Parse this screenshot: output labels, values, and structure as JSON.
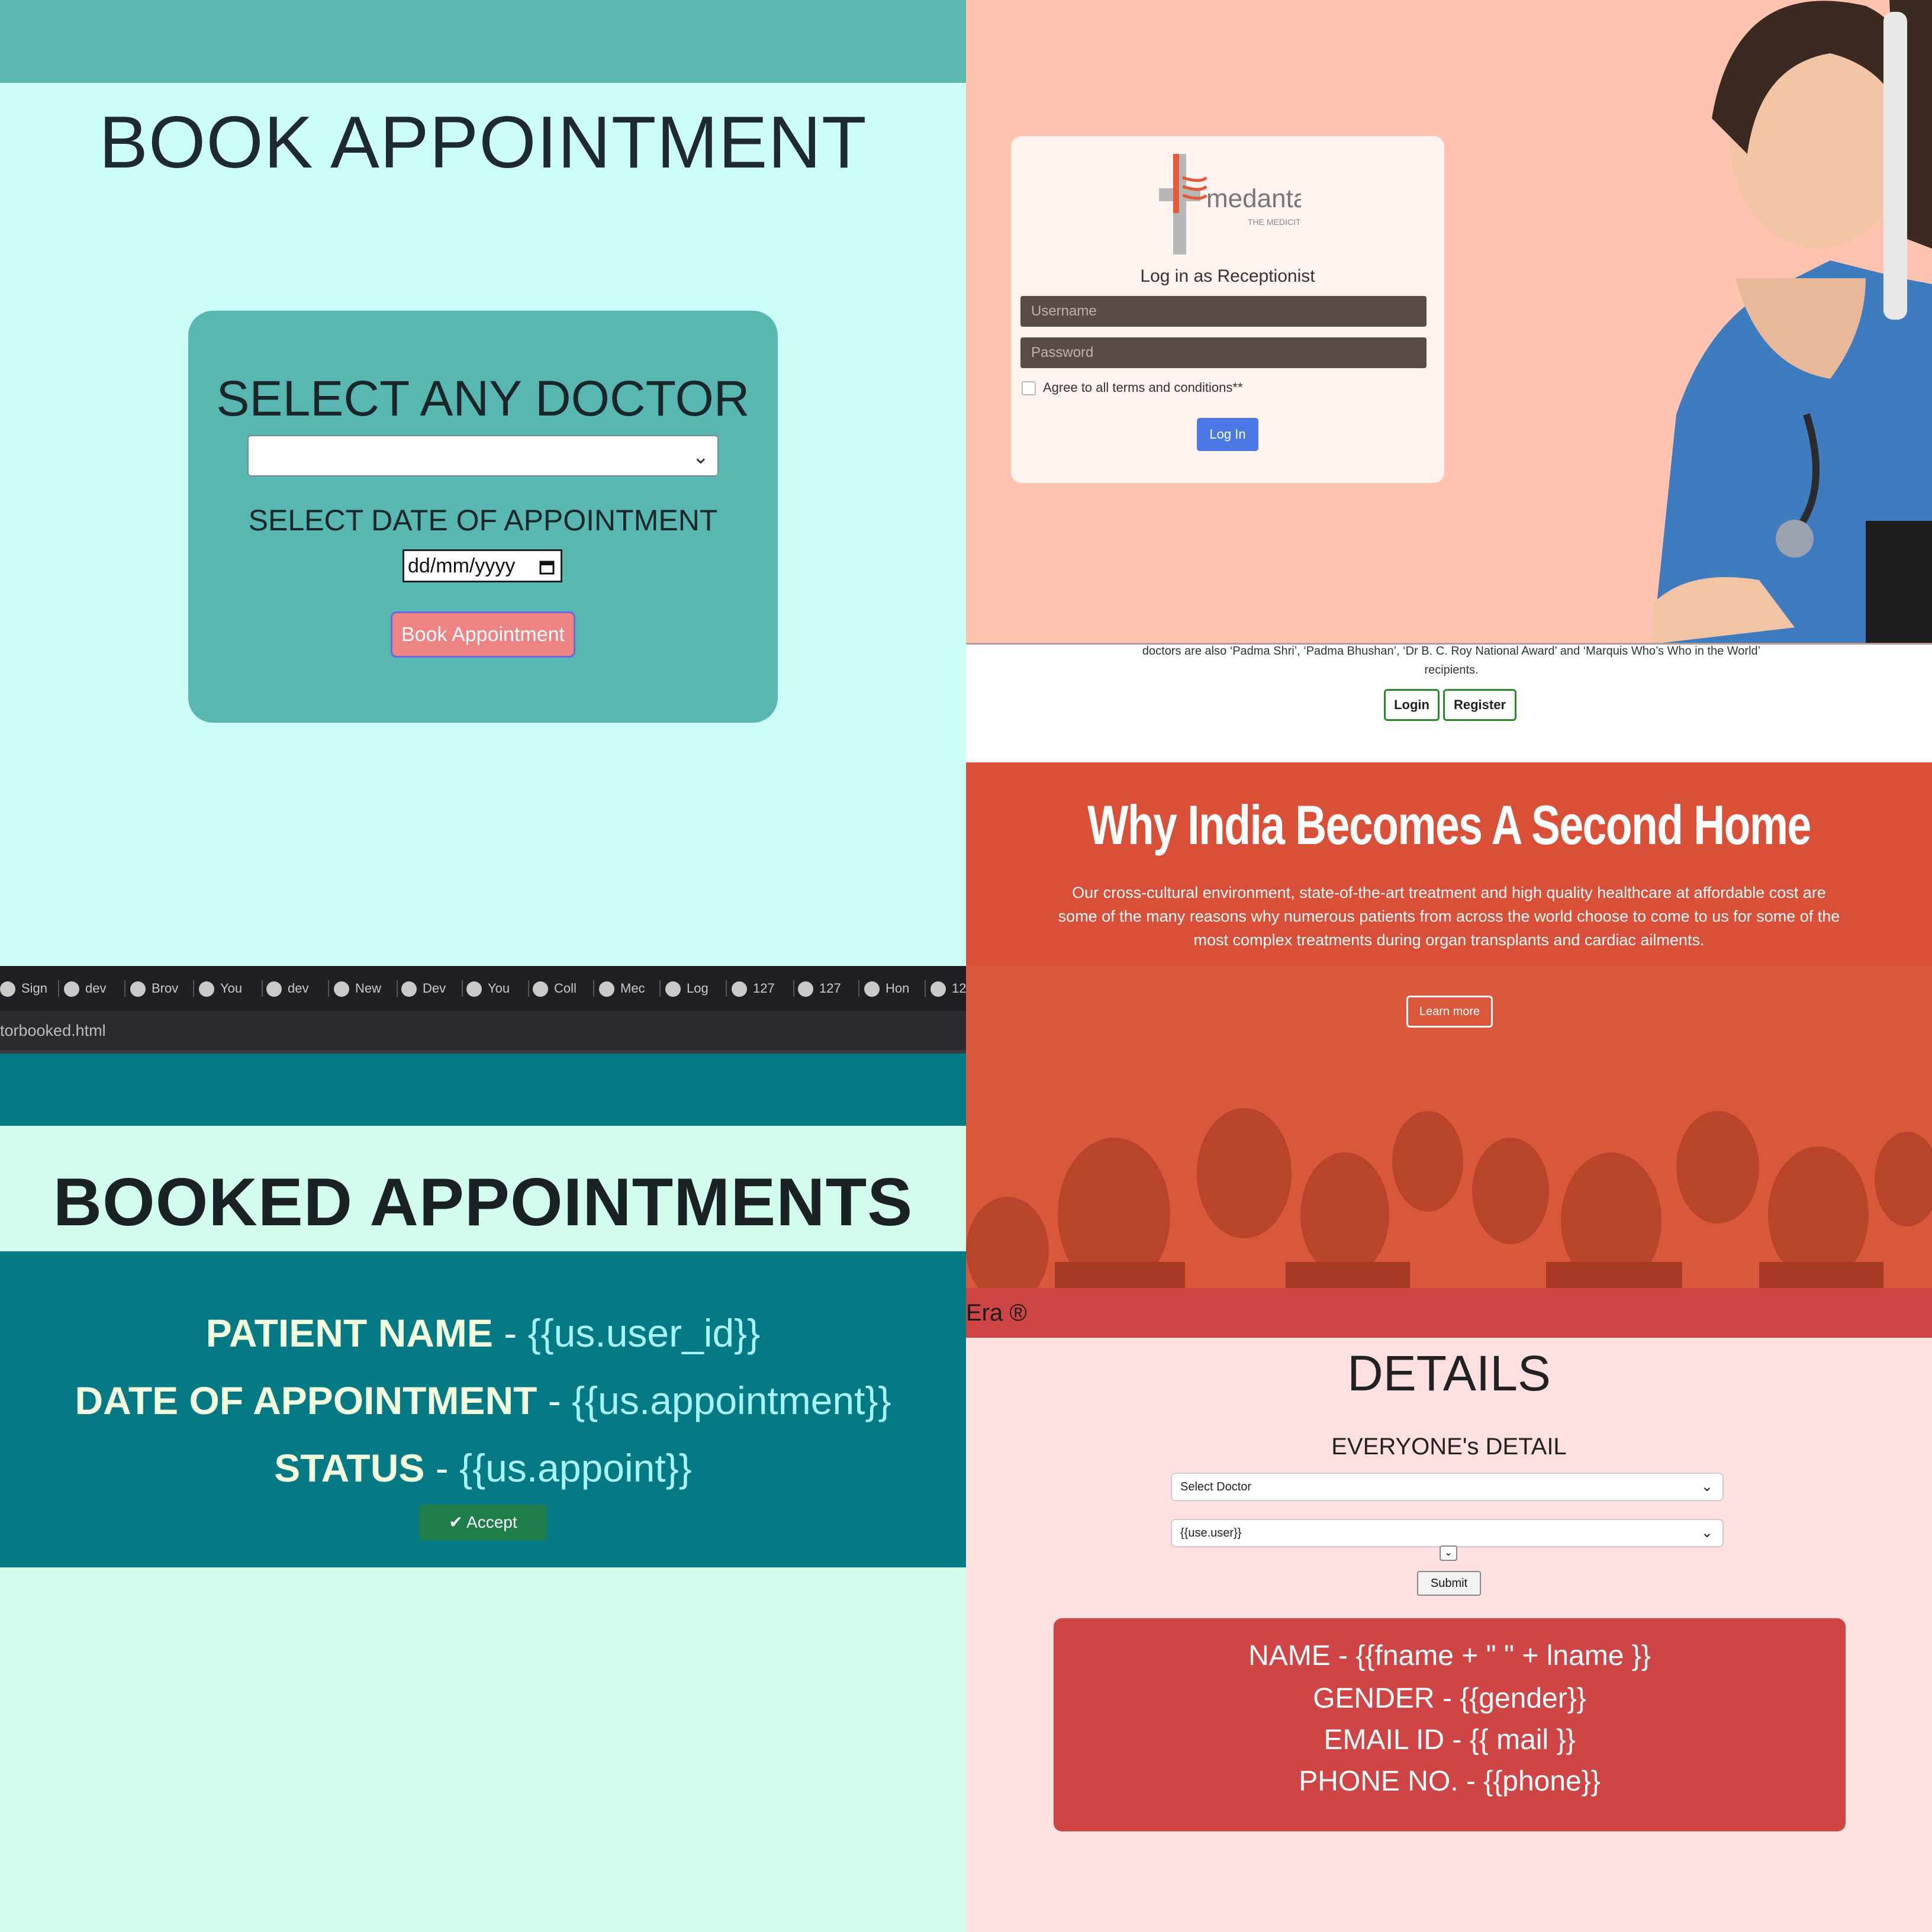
{
  "book": {
    "title": "BOOK APPOINTMENT",
    "doctor_label": "SELECT ANY DOCTOR",
    "doctor_value": "",
    "date_label": "SELECT DATE OF APPOINTMENT",
    "date_placeholder": "dd/mm/yyyy",
    "button": "Book Appointment"
  },
  "login": {
    "logo_text": "medanta",
    "logo_sub": "THE MEDICITY",
    "title": "Log in as Receptionist",
    "username_placeholder": "Username",
    "password_placeholder": "Password",
    "agree": "Agree to all terms and conditions**",
    "button": "Log In",
    "about_text": "doctors are also ‘Padma Shri’, ‘Padma Bhushan’, ‘Dr B. C. Roy National Award’ and ‘Marquis Who’s Who in the World’ recipients.",
    "nav_login": "Login",
    "nav_register": "Register",
    "why_title": "Why India Becomes A Second Home",
    "why_text": "Our cross-cultural environment, state-of-the-art treatment and high quality healthcare at affordable cost are some of the many reasons why numerous patients from across the world choose to come to us for some of the most complex treatments during organ transplants and cardiac ailments.",
    "learn_more": "Learn more",
    "colors": {
      "hero_bg": "#ffc3b0",
      "button_blue": "#4b79e6",
      "section_red": "#d94f37"
    }
  },
  "browser": {
    "tabs": [
      "Sign",
      "dev",
      "Brov",
      "You",
      "dev",
      "New",
      "Dev",
      "You",
      "Coll",
      "Mec",
      "Log",
      "127",
      "127",
      "Hon",
      "12"
    ],
    "url": "torbooked.html"
  },
  "booked": {
    "title": "BOOKED APPOINTMENTS",
    "patient_label": "PATIENT NAME",
    "patient_value": "{{us.user_id}}",
    "date_label": "DATE OF APPOINTMENT",
    "date_value": "{{us.appointment}}",
    "status_label": "STATUS",
    "status_value": "{{us.appoint}}",
    "separator": " - ",
    "accept_button": "✔ Accept"
  },
  "details": {
    "band_text": "Era ®",
    "title": "DETAILS",
    "subtitle": "EVERYONE's DETAIL",
    "select_doctor": "Select Doctor",
    "select_user": "{{use.user}}",
    "submit": "Submit",
    "name_line": "NAME - {{fname + \" \" + lname }}",
    "gender_line": "GENDER - {{gender}}",
    "email_line": "EMAIL ID - {{ mail }}",
    "phone_line": "PHONE NO. - {{phone}}"
  }
}
